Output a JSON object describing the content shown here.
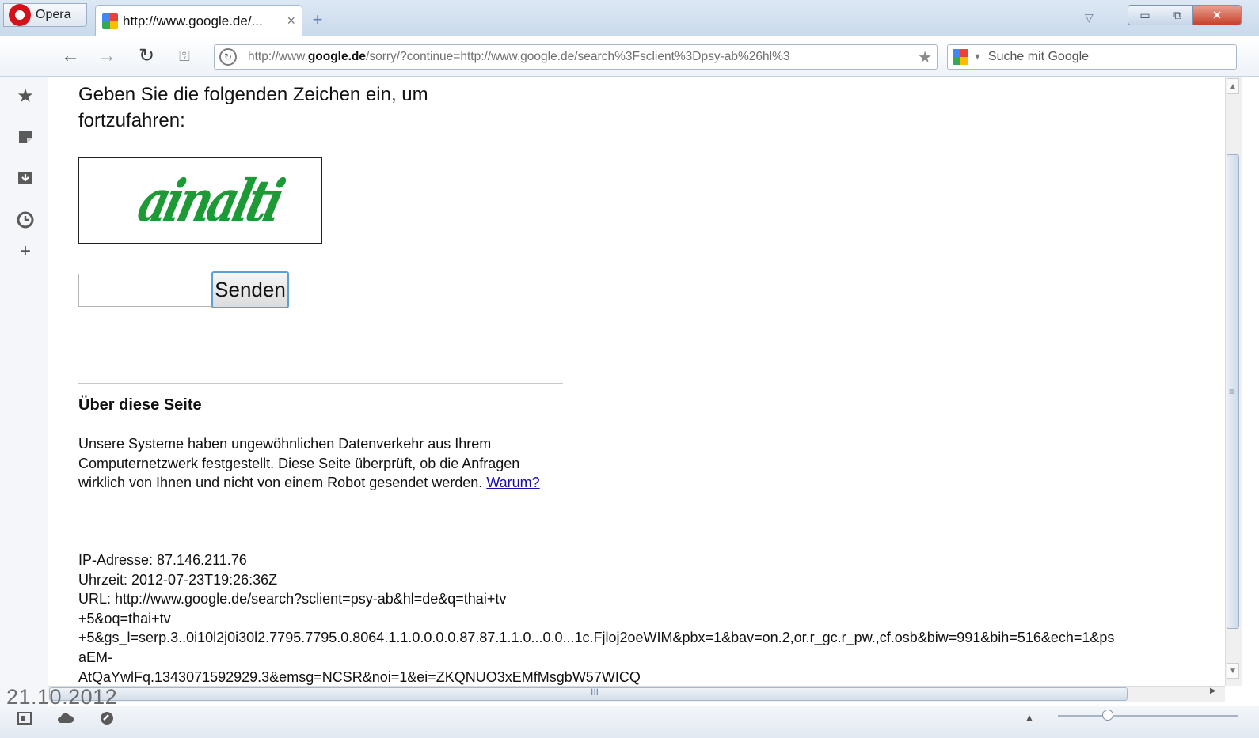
{
  "browser": {
    "menu_label": "Opera",
    "tab": {
      "title": "http://www.google.de/...",
      "close": "×"
    },
    "new_tab": "+",
    "window_controls": {
      "minimize": "▭",
      "maximize": "⧉",
      "close": "✕"
    }
  },
  "toolbar": {
    "back": "←",
    "forward": "→",
    "reload": "↻",
    "key": "⚿",
    "address_prefix": "http://www.",
    "address_domain": "google.de",
    "address_path": "/sorry/?continue=http://www.google.de/search%3Fsclient%3Dpsy-ab%26hl%3",
    "search_placeholder": "Suche mit Google"
  },
  "page": {
    "heading": "Geben Sie die folgenden Zeichen ein, um fortzufahren:",
    "captcha_text": "ainalti",
    "submit_label": "Senden",
    "about_heading": "Über diese Seite",
    "about_text": "Unsere Systeme haben ungewöhnlichen Datenverkehr aus Ihrem Computernetzwerk festgestellt. Diese Seite überprüft, ob die Anfragen wirklich von Ihnen und nicht von einem Robot gesendet werden.",
    "why_link": "Warum?",
    "diagnostics": [
      "IP-Adresse: 87.146.211.76",
      "Uhrzeit: 2012-07-23T19:26:36Z",
      "URL: http://www.google.de/search?sclient=psy-ab&hl=de&q=thai+tv",
      "+5&oq=thai+tv",
      "+5&gs_l=serp.3..0i10l2j0i30l2.7795.7795.0.8064.1.1.0.0.0.0.87.87.1.1.0...0.0...1c.Fjloj2oeWIM&pbx=1&bav=on.2,or.r_gc.r_pw.,cf.osb&biw=991&bih=516&ech=1&ps",
      "aEM-",
      "AtQaYwlFq.1343071592929.3&emsg=NCSR&noi=1&ei=ZKQNUO3xEMfMsgbW57WICQ"
    ]
  },
  "overlay": {
    "date": "21.10.2012"
  },
  "scrollbars": {
    "h_grip": "III",
    "v_grip": "≡"
  },
  "colors": {
    "captcha": "#1d9a36",
    "link": "#1a0dab",
    "opera_red": "#d4121a"
  },
  "icons": {
    "sidebar": [
      "bookmarks-star-icon",
      "notes-icon",
      "downloads-icon",
      "history-clock-icon",
      "add-panel-icon"
    ],
    "status": [
      "panel-toggle-icon",
      "opera-unite-cloud-icon",
      "turbo-icon"
    ]
  }
}
